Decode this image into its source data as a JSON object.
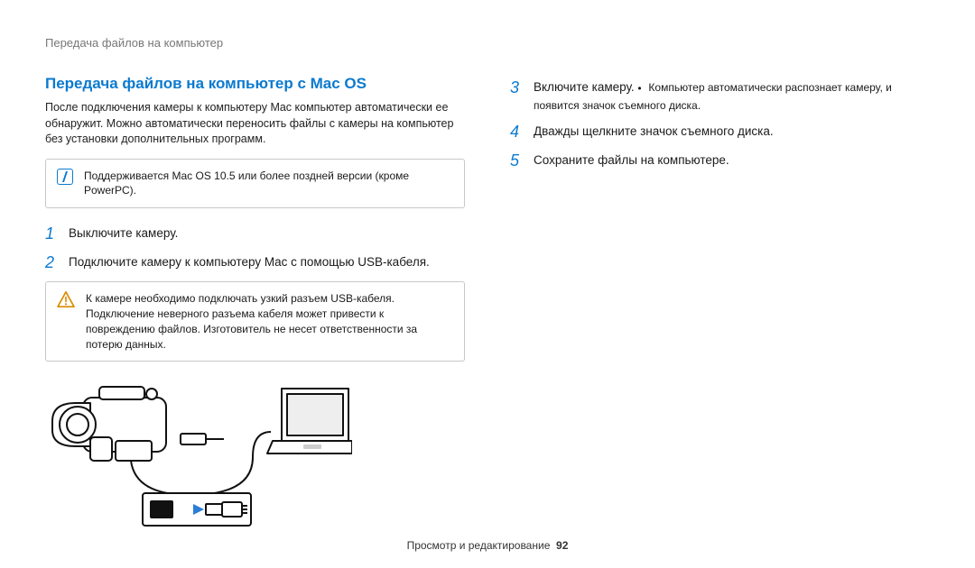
{
  "breadcrumb": "Передача файлов на компьютер",
  "section_title": "Передача файлов на компьютер с Mac OS",
  "intro": "После подключения камеры к компьютеру Mac компьютер автоматически ее обнаружит. Можно автоматически переносить файлы с камеры на компьютер без установки дополнительных программ.",
  "note_info": "Поддерживается Mac OS 10.5 или более поздней версии (кроме PowerPC).",
  "steps_left": [
    {
      "n": "1",
      "text": "Выключите камеру."
    },
    {
      "n": "2",
      "text": "Подключите камеру к компьютеру Mac с помощью USB-кабеля."
    }
  ],
  "warn_line1": "К камере необходимо подключать узкий разъем USB-кабеля.",
  "warn_line2": "Подключение неверного разъема кабеля может привести к повреждению файлов. Изготовитель не несет ответственности за потерю данных.",
  "steps_right": [
    {
      "n": "3",
      "text": "Включите камеру.",
      "sub": "Компьютер автоматически распознает камеру, и появится значок съемного диска."
    },
    {
      "n": "4",
      "text": "Дважды щелкните значок съемного диска."
    },
    {
      "n": "5",
      "text": "Сохраните файлы на компьютере."
    }
  ],
  "footer_text": "Просмотр и редактирование",
  "footer_page": "92"
}
